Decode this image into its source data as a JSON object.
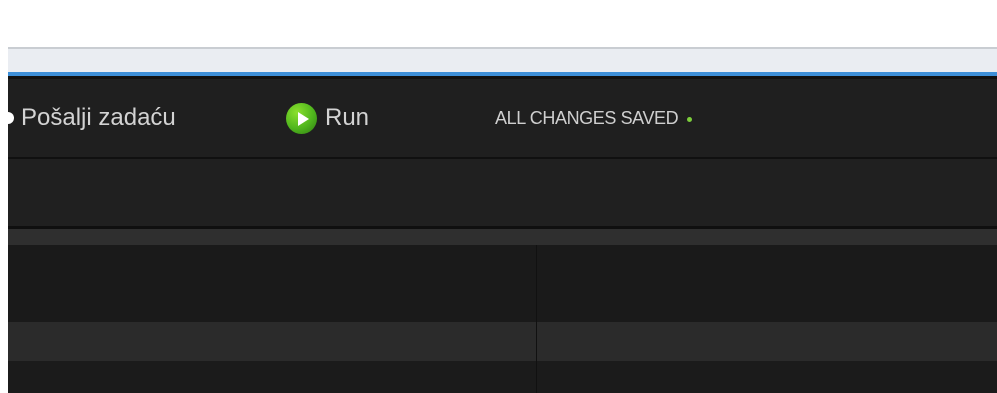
{
  "toolbar": {
    "submit_label": "Pošalji zadaću",
    "run_label": "Run",
    "save_status": "ALL CHANGES SAVED"
  },
  "icons": {
    "submit_dot": "dot-icon",
    "run": "play-icon",
    "saved_status": "status-dot-icon"
  },
  "colors": {
    "accent_blue": "#3d8fd8",
    "run_green": "#4fb51d",
    "saved_green": "#7cce3b",
    "toolbar_bg": "#1f1f1f"
  }
}
